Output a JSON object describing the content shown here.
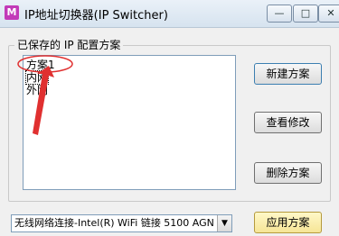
{
  "window": {
    "title": "IP地址切换器(IP Switcher)",
    "icon": "app-icon",
    "icon_text": "M",
    "min_glyph": "—",
    "max_glyph": "□",
    "close_glyph": "✕"
  },
  "group": {
    "label": "已保存的 IP 配置方案"
  },
  "profiles": [
    {
      "label": "方案1"
    },
    {
      "label": "内网"
    },
    {
      "label": "外网"
    }
  ],
  "buttons": {
    "new": "新建方案",
    "edit": "查看修改",
    "delete": "删除方案",
    "apply": "应用方案"
  },
  "adapter_select": {
    "value": "无线网络连接-Intel(R) WiFi 链接 5100 AGN",
    "arrow": "▼"
  },
  "annotation": {
    "color": "#e03030"
  }
}
